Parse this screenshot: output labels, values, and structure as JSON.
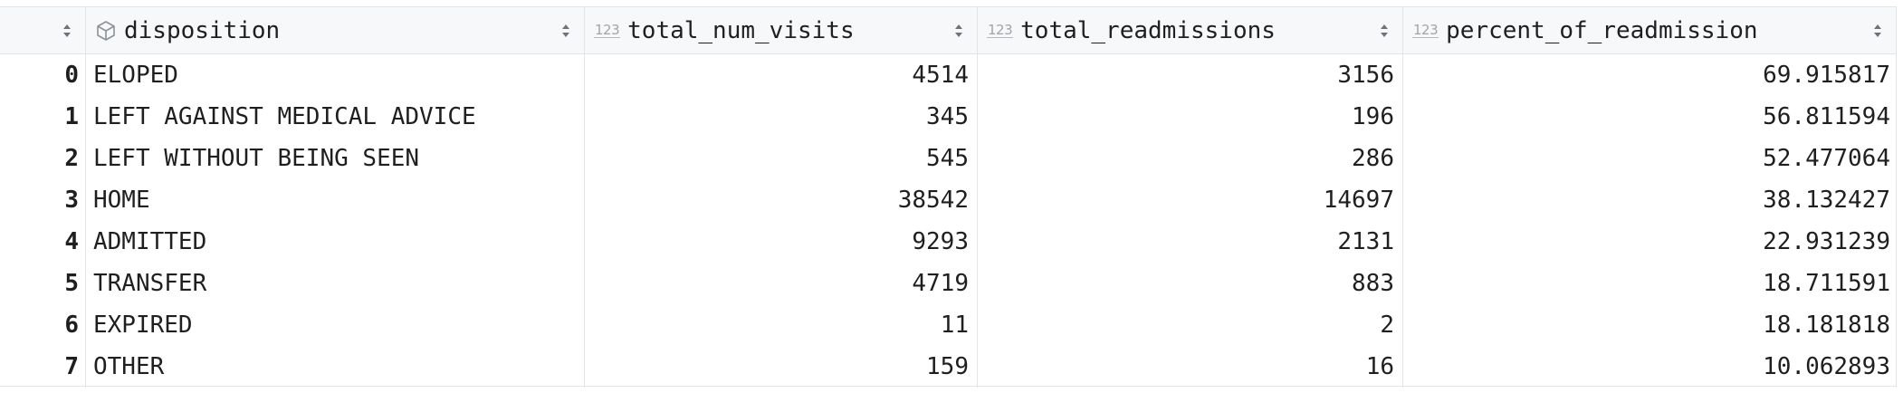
{
  "table": {
    "columns": [
      {
        "label": "disposition",
        "type_icon": "cube-icon"
      },
      {
        "label": "total_num_visits",
        "type_icon": "numeric-123-icon",
        "type_text": "123"
      },
      {
        "label": "total_readmissions",
        "type_icon": "numeric-123-icon",
        "type_text": "123"
      },
      {
        "label": "percent_of_readmission",
        "type_icon": "numeric-123-icon",
        "type_text": "123"
      }
    ],
    "rows": [
      {
        "index": "0",
        "disposition": "ELOPED",
        "total_num_visits": "4514",
        "total_readmissions": "3156",
        "percent_of_readmission": "69.915817"
      },
      {
        "index": "1",
        "disposition": "LEFT AGAINST MEDICAL ADVICE",
        "total_num_visits": "345",
        "total_readmissions": "196",
        "percent_of_readmission": "56.811594"
      },
      {
        "index": "2",
        "disposition": "LEFT WITHOUT BEING SEEN",
        "total_num_visits": "545",
        "total_readmissions": "286",
        "percent_of_readmission": "52.477064"
      },
      {
        "index": "3",
        "disposition": "HOME",
        "total_num_visits": "38542",
        "total_readmissions": "14697",
        "percent_of_readmission": "38.132427"
      },
      {
        "index": "4",
        "disposition": "ADMITTED",
        "total_num_visits": "9293",
        "total_readmissions": "2131",
        "percent_of_readmission": "22.931239"
      },
      {
        "index": "5",
        "disposition": "TRANSFER",
        "total_num_visits": "4719",
        "total_readmissions": "883",
        "percent_of_readmission": "18.711591"
      },
      {
        "index": "6",
        "disposition": "EXPIRED",
        "total_num_visits": "11",
        "total_readmissions": "2",
        "percent_of_readmission": "18.181818"
      },
      {
        "index": "7",
        "disposition": "OTHER",
        "total_num_visits": "159",
        "total_readmissions": "16",
        "percent_of_readmission": "10.062893"
      }
    ]
  }
}
